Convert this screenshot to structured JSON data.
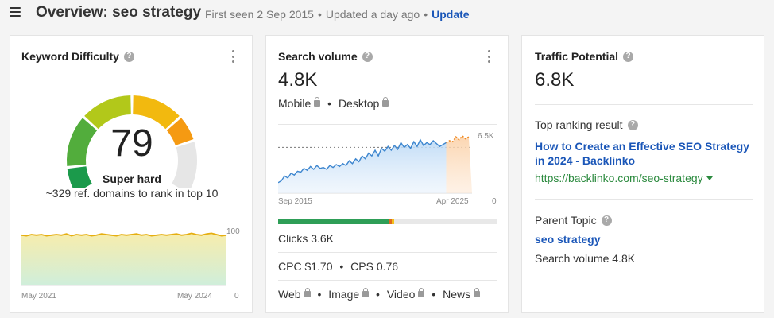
{
  "header": {
    "title": "Overview: seo strategy",
    "first_seen": "First seen 2 Sep 2015",
    "dot": "•",
    "updated": "Updated a day ago",
    "update_label": "Update"
  },
  "kd_card": {
    "title": "Keyword Difficulty",
    "help": "?",
    "score": "79",
    "score_label": "Super hard",
    "subtitle": "~329 ref. domains to rank in top 10",
    "score_fraction": 0.79,
    "chart": {
      "x_start": "May 2021",
      "x_end": "May 2024",
      "y_max": "100",
      "y_min": "0",
      "values": [
        79,
        78,
        80,
        79,
        80,
        78,
        79,
        80,
        79,
        81,
        78,
        80,
        79,
        80,
        78,
        79,
        81,
        80,
        79,
        78,
        80,
        79,
        80,
        81,
        79,
        80,
        78,
        79,
        80,
        79,
        80,
        81,
        79,
        80,
        82,
        80,
        79,
        81,
        82,
        80,
        78,
        79
      ]
    }
  },
  "sv_card": {
    "title": "Search volume",
    "help": "?",
    "value": "4.8K",
    "devices": [
      "Mobile",
      "Desktop"
    ],
    "chart": {
      "x_start": "Sep 2015",
      "x_end": "Apr 2025",
      "y_max": "6.5K",
      "y_min": "0",
      "values": [
        1100,
        1300,
        1800,
        1600,
        2100,
        1900,
        2300,
        2200,
        2600,
        2400,
        2800,
        2500,
        2900,
        2600,
        2700,
        2500,
        2900,
        2700,
        3000,
        2800,
        3100,
        2900,
        3400,
        3100,
        3600,
        3300,
        3900,
        3600,
        4200,
        3900,
        4500,
        3900,
        4700,
        4400,
        4900,
        4500,
        5000,
        4600,
        5300,
        4800,
        5100,
        4700,
        5400,
        4900,
        5600,
        5000,
        5300,
        5100,
        5500,
        5200,
        4900,
        5100,
        5300
      ],
      "forecast": [
        5300,
        5500,
        5400,
        5900,
        5600,
        6000,
        5700,
        5900
      ],
      "reference": 4800
    },
    "clicks_bar": {
      "segments": [
        {
          "name": "organic",
          "fraction": 0.51,
          "color": "#2e9e57"
        },
        {
          "name": "paid-a",
          "fraction": 0.01,
          "color": "#e0691c"
        },
        {
          "name": "paid-b",
          "fraction": 0.01,
          "color": "#f1c11c"
        },
        {
          "name": "no-clicks",
          "fraction": 0.47,
          "color": "#e8e8e8"
        }
      ]
    },
    "clicks_label": "Clicks 3.6K",
    "cpc_label": "CPC $1.70",
    "dot": "•",
    "cps_label": "CPS 0.76",
    "serp_features": [
      "Web",
      "Image",
      "Video",
      "News"
    ]
  },
  "tp_card": {
    "title": "Traffic Potential",
    "help": "?",
    "value": "6.8K",
    "top_result_label": "Top ranking result",
    "top_result_title": "How to Create an Effective SEO Strategy in 2024 - Backlinko",
    "top_result_url": "https://backlinko.com/seo-strategy",
    "parent_topic_label": "Parent Topic",
    "parent_topic": "seo strategy",
    "parent_volume": "Search volume 4.8K"
  }
}
